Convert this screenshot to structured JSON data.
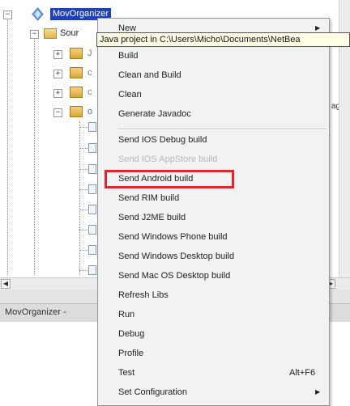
{
  "tree": {
    "project_name": "MovOrganizer",
    "source_label": "Sour",
    "pkg_letters": [
      "J",
      "c",
      "c",
      "o"
    ],
    "right_text": "age"
  },
  "status_tab": "MovOrganizer -",
  "tooltip": "Java project in C:\\Users\\Micho\\Documents\\NetBea",
  "menu": {
    "new_label": "New",
    "items": [
      {
        "label": "Build"
      },
      {
        "label": "Clean and Build"
      },
      {
        "label": "Clean"
      },
      {
        "label": "Generate Javadoc"
      },
      {
        "label": "Send IOS Debug build"
      },
      {
        "label": "Send IOS AppStore build"
      },
      {
        "label": "Send Android build"
      },
      {
        "label": "Send RIM build"
      },
      {
        "label": "Send J2ME build"
      },
      {
        "label": "Send Windows Phone build"
      },
      {
        "label": "Send Windows Desktop build"
      },
      {
        "label": "Send Mac OS Desktop build"
      },
      {
        "label": "Refresh Libs"
      },
      {
        "label": "Run"
      },
      {
        "label": "Debug"
      },
      {
        "label": "Profile"
      },
      {
        "label": "Test",
        "shortcut": "Alt+F6"
      },
      {
        "label": "Set Configuration"
      }
    ]
  },
  "colors": {
    "highlight": "#e3262b",
    "selection": "#1f43b7",
    "tooltip_bg": "#ffffe6",
    "menu_bg": "#f2f2f2"
  },
  "icons": [
    "project-icon",
    "folder-icon",
    "package-icon",
    "file-icon",
    "submenu-arrow-icon",
    "expand-icon",
    "collapse-icon"
  ]
}
